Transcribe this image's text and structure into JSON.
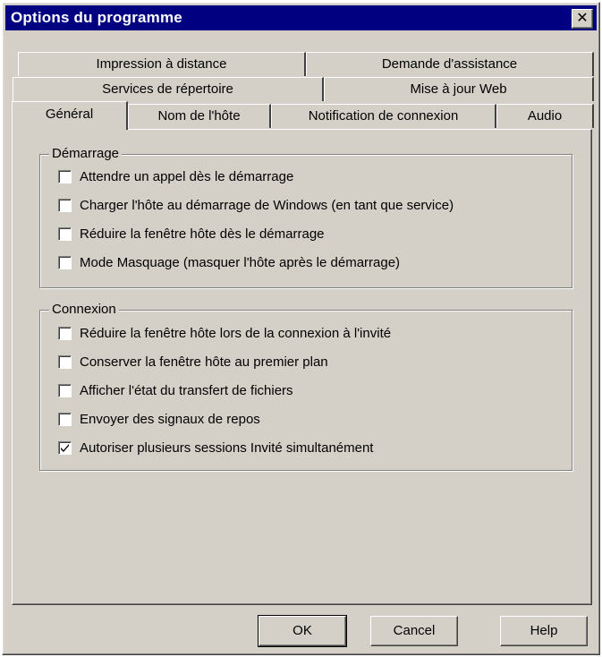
{
  "window": {
    "title": "Options du programme"
  },
  "tabs": {
    "row1": [
      "Impression à distance",
      "Demande d'assistance"
    ],
    "row2": [
      "Services de répertoire",
      "Mise à jour Web"
    ],
    "row3": [
      "Général",
      "Nom de l'hôte",
      "Notification de connexion",
      "Audio"
    ],
    "active": "Général"
  },
  "groups": {
    "startup": {
      "label": "Démarrage",
      "items": [
        {
          "label": "Attendre un appel dès le démarrage",
          "checked": false
        },
        {
          "label": "Charger l'hôte au démarrage de Windows (en tant que service)",
          "checked": false
        },
        {
          "label": "Réduire la fenêtre hôte dès le démarrage",
          "checked": false
        },
        {
          "label": "Mode Masquage (masquer l'hôte après le démarrage)",
          "checked": false
        }
      ]
    },
    "connection": {
      "label": "Connexion",
      "items": [
        {
          "label": "Réduire la fenêtre hôte lors de la connexion à l'invité",
          "checked": false
        },
        {
          "label": "Conserver la fenêtre hôte au premier plan",
          "checked": false
        },
        {
          "label": "Afficher l'état du transfert de fichiers",
          "checked": false
        },
        {
          "label": "Envoyer des signaux de repos",
          "checked": false
        },
        {
          "label": "Autoriser plusieurs sessions Invité simultanément",
          "checked": true
        }
      ]
    }
  },
  "buttons": {
    "ok": "OK",
    "cancel": "Cancel",
    "help": "Help"
  },
  "colors": {
    "titlebar": "#000080",
    "face": "#d4d0c8"
  }
}
